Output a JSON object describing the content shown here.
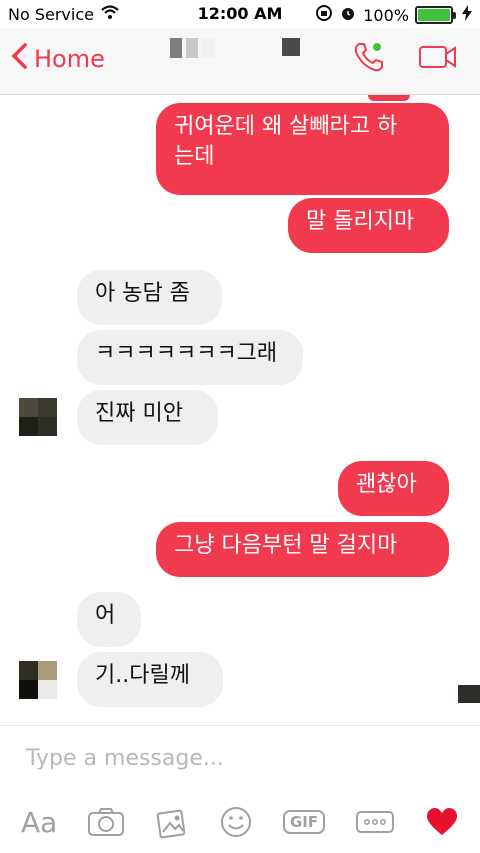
{
  "status": {
    "carrier": "No Service",
    "time": "12:00 AM",
    "battery_percent": "100%",
    "battery_level": 1.0
  },
  "nav": {
    "back_label": "Home",
    "accent": "#f03a4e"
  },
  "messages": [
    {
      "dir": "out",
      "text": "귀여운데 왜 살빼라고 하\n는데"
    },
    {
      "dir": "out",
      "text": "말 돌리지마"
    },
    {
      "dir": "in",
      "text": "아 농담 좀"
    },
    {
      "dir": "in",
      "text": "ㅋㅋㅋㅋㅋㅋㅋ그래"
    },
    {
      "dir": "in",
      "text": "진짜 미안"
    },
    {
      "dir": "out",
      "text": "괜찮아"
    },
    {
      "dir": "out",
      "text": "그냥 다음부턴 말 걸지마"
    },
    {
      "dir": "in",
      "text": "어"
    },
    {
      "dir": "in",
      "text": "기..다릴께"
    }
  ],
  "composer": {
    "placeholder": "Type a message...",
    "aa_label": "Aa",
    "gif_label": "GIF"
  },
  "colors": {
    "outgoing_bubble": "#f23a4e",
    "incoming_bubble": "#efefef",
    "battery": "#41c23d",
    "heart": "#e8112d"
  },
  "icons": [
    "wifi-icon",
    "lock-rotation-icon",
    "alarm-icon",
    "charging-icon",
    "back-chevron-icon",
    "phone-icon",
    "video-icon",
    "camera-icon",
    "photo-icon",
    "emoji-icon",
    "more-icon",
    "heart-icon"
  ]
}
